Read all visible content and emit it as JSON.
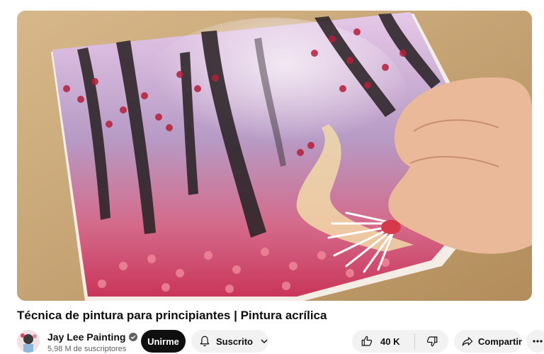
{
  "video": {
    "title": "Técnica de pintura para principiantes | Pintura acrílica",
    "thumbnail_icon": "painting-video-frame"
  },
  "channel": {
    "name": "Jay Lee Painting",
    "subscribers": "5,98 M de suscriptores",
    "verified_icon": "verified-check-icon"
  },
  "actions": {
    "join_label": "Unirme",
    "subscribed_label": "Suscrito",
    "like_count": "40 K",
    "share_label": "Compartir"
  },
  "colors": {
    "primary_button": "#0f0f0f",
    "secondary_button": "#f2f2f2",
    "secondary_text": "#606060"
  }
}
